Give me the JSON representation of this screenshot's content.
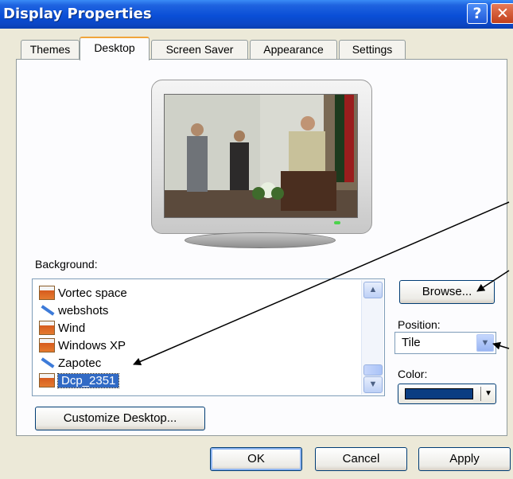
{
  "window": {
    "title": "Display Properties",
    "help_label": "?",
    "close_label": "✕"
  },
  "tabs": [
    {
      "label": "Themes",
      "active": false
    },
    {
      "label": "Desktop",
      "active": true
    },
    {
      "label": "Screen Saver",
      "active": false
    },
    {
      "label": "Appearance",
      "active": false
    },
    {
      "label": "Settings",
      "active": false
    }
  ],
  "desktop": {
    "background_label": "Background:",
    "background_items": [
      {
        "label": "Vortec space",
        "icon": "image-file-icon"
      },
      {
        "label": "webshots",
        "icon": "shortcut-icon"
      },
      {
        "label": "Wind",
        "icon": "image-file-icon"
      },
      {
        "label": "Windows XP",
        "icon": "image-file-icon"
      },
      {
        "label": "Zapotec",
        "icon": "shortcut-icon"
      },
      {
        "label": "Dcp_2351",
        "icon": "image-file-icon",
        "selected": true
      }
    ],
    "browse_label": "Browse...",
    "position_label": "Position:",
    "position_value": "Tile",
    "color_label": "Color:",
    "color_value": "#0a3d82",
    "customize_label": "Customize Desktop..."
  },
  "buttons": {
    "ok": "OK",
    "cancel": "Cancel",
    "apply": "Apply"
  },
  "colors": {
    "title_bar": "#0a4fd7",
    "selection": "#316ac5",
    "tab_highlight": "#f0a53b"
  }
}
